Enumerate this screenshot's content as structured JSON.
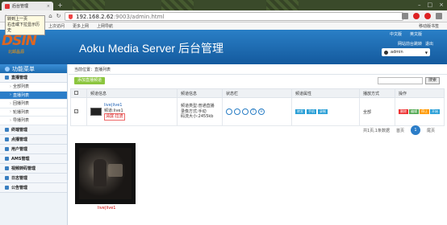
{
  "browser": {
    "tab_title": "后台管理",
    "url_host": "192.168.2.62",
    "url_rest": ":9003/admin.html",
    "bookmarks": [
      "",
      "上次访问",
      "更多上网",
      "上网导航"
    ],
    "bookmark_right": "移动版书签"
  },
  "tooltip": {
    "line1": "转到上一页",
    "line2": "右击或下拉显示历史"
  },
  "header": {
    "logo_text": "DSIN",
    "logo_sub": "北邮晶源",
    "title": "Aoku Media Server 后台管理",
    "lang_cn": "中文版",
    "lang_en": "英文版",
    "link_help": "网站前台跳转",
    "link_logout": "退出",
    "user": "admin"
  },
  "sidebar": {
    "title": "功能菜单",
    "groups": [
      {
        "label": "直播管理"
      },
      {
        "label": "终端管理"
      },
      {
        "label": "点播管理"
      },
      {
        "label": "用户管理"
      },
      {
        "label": "AMS管理"
      },
      {
        "label": "视频转码管理"
      },
      {
        "label": "日志管理"
      },
      {
        "label": "公告管理"
      }
    ],
    "items": [
      "全部列表",
      "直播列表",
      "回播列表",
      "轮播列表",
      "导播列表"
    ]
  },
  "main": {
    "breadcrumb": "当前位置：直播列表",
    "add_button": "添加直播频道",
    "search_placeholder": "",
    "search_button": "搜索",
    "columns": [
      "",
      "频道信息",
      "频道信息",
      "状态栏",
      "频道属性",
      "播放方式",
      "操作"
    ],
    "row": {
      "name": "live|live1",
      "name2": "频道:live1",
      "play_tag": "清屏:拉流",
      "info": [
        "频道类型:普通直播",
        "录像方式:手动",
        "码流大小:2455kb"
      ],
      "status_icons": [
        "",
        "",
        "",
        "T",
        "H"
      ],
      "tags": [
        "转发",
        "手机",
        "录制"
      ],
      "play_mode": "全部",
      "ops": [
        "删除",
        "编辑",
        "停止",
        "开始"
      ]
    },
    "pager": {
      "summary": "共1页,1条数据",
      "first": "首页",
      "current": "1",
      "last": "尾页"
    },
    "preview_label": "live|live1"
  },
  "colors": {
    "header_blue": "#1d6bb0",
    "active_item": "#2b7dc8",
    "add_green": "#8cc63f",
    "logo_orange": "#d62"
  }
}
